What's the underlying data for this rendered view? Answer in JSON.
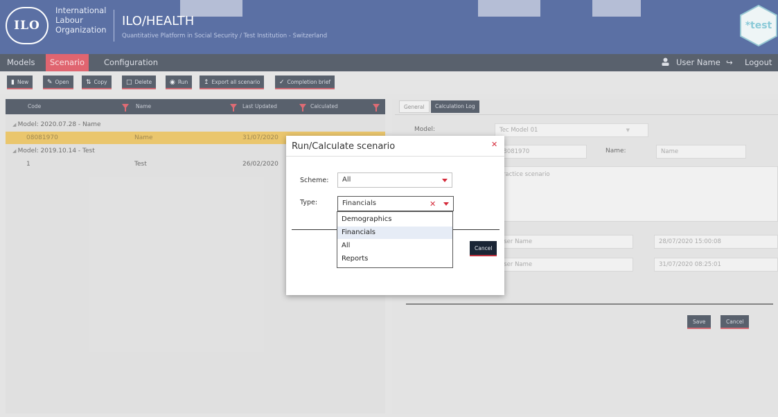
{
  "header": {
    "logo_emblem": "ILO",
    "org_name": [
      "International",
      "Labour",
      "Organization"
    ],
    "app_title": "ILO/HEALTH",
    "app_subtitle": "Quantitative Platform in Social Security / Test Institution - Switzerland",
    "env_badge": "*test"
  },
  "nav": {
    "items": [
      "Models",
      "Scenario",
      "Configuration"
    ],
    "active": "Scenario",
    "user_name": "User Name",
    "logout": "Logout"
  },
  "toolbar": {
    "new": "New",
    "open": "Open",
    "copy": "Copy",
    "delete": "Delete",
    "run": "Run",
    "export": "Export all scenario",
    "completion": "Completion brief"
  },
  "grid": {
    "columns": [
      "Code",
      "Name",
      "Last Updated",
      "Calculated"
    ],
    "groups": [
      {
        "label": "Model: 2020.07.28 - Name",
        "rows": [
          {
            "code": "08081970",
            "name": "Name",
            "updated": "31/07/2020",
            "selected": true
          }
        ]
      },
      {
        "label": "Model: 2019.10.14 - Test",
        "rows": [
          {
            "code": "1",
            "name": "Test",
            "updated": "26/02/2020",
            "selected": false
          }
        ]
      }
    ]
  },
  "details": {
    "tabs": [
      "General",
      "Calculation Log"
    ],
    "active_tab": "Calculation Log",
    "model_label": "Model:",
    "model_value": "Tec Model 01",
    "code_value": "08081970",
    "name_label": "Name:",
    "name_value": "Name",
    "description": "Practice scenario",
    "created_by": "User Name",
    "created_at": "28/07/2020 15:00:08",
    "updated_by": "User Name",
    "updated_at": "31/07/2020 08:25:01",
    "save": "Save",
    "cancel": "Cancel"
  },
  "modal": {
    "title": "Run/Calculate scenario",
    "scheme_label": "Scheme:",
    "scheme_value": "All",
    "type_label": "Type:",
    "type_value": "Financials",
    "type_options": [
      "Demographics",
      "Financials",
      "All",
      "Reports"
    ],
    "highlighted_option": "Financials",
    "cancel": "Cancel"
  },
  "colors": {
    "header": "#1d3a82",
    "nav": "#1a2535",
    "accent": "#d52a3a",
    "selected_row": "#e2b035"
  }
}
